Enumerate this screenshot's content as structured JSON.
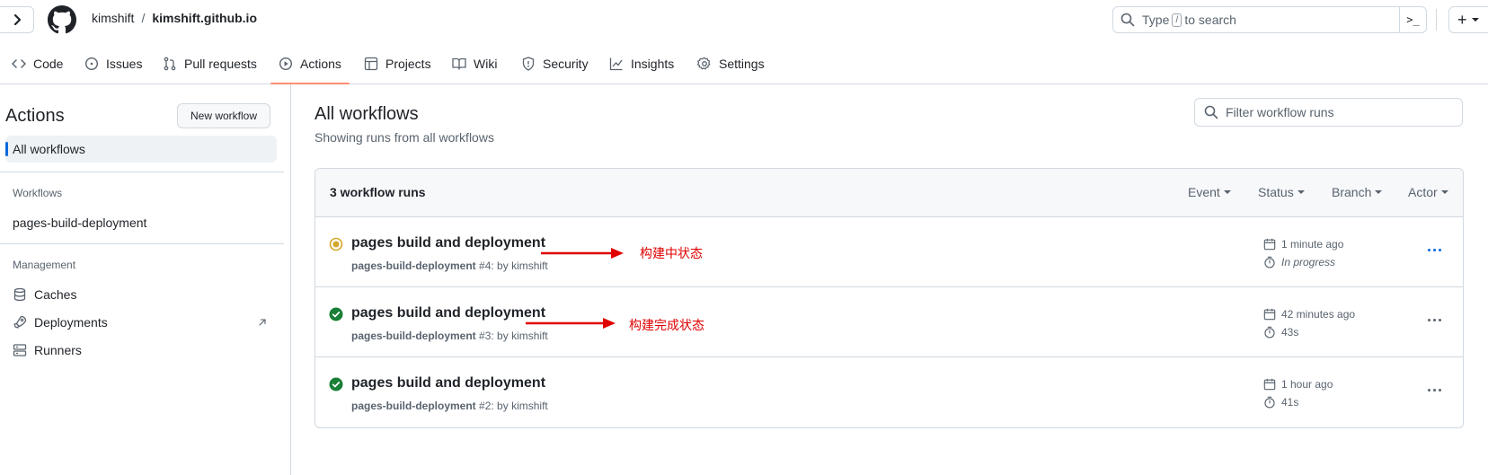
{
  "header": {
    "owner": "kimshift",
    "separator": "/",
    "repo": "kimshift.github.io",
    "search_prefix": "Type",
    "search_key": "/",
    "search_suffix": "to search",
    "terminal_glyph": ">_",
    "plus_glyph": "+"
  },
  "tabs": [
    {
      "label": "Code",
      "icon": "code-icon"
    },
    {
      "label": "Issues",
      "icon": "issue-icon"
    },
    {
      "label": "Pull requests",
      "icon": "pull-request-icon"
    },
    {
      "label": "Actions",
      "icon": "play-icon",
      "active": true
    },
    {
      "label": "Projects",
      "icon": "table-icon"
    },
    {
      "label": "Wiki",
      "icon": "book-icon"
    },
    {
      "label": "Security",
      "icon": "shield-icon"
    },
    {
      "label": "Insights",
      "icon": "graph-icon"
    },
    {
      "label": "Settings",
      "icon": "gear-icon"
    }
  ],
  "sidebar": {
    "title": "Actions",
    "new_workflow": "New workflow",
    "all_workflows": "All workflows",
    "workflows_heading": "Workflows",
    "workflow_item": "pages-build-deployment",
    "management_heading": "Management",
    "management_items": [
      {
        "label": "Caches",
        "icon": "database-icon"
      },
      {
        "label": "Deployments",
        "icon": "rocket-icon"
      },
      {
        "label": "Runners",
        "icon": "server-icon"
      }
    ]
  },
  "main": {
    "title": "All workflows",
    "subtitle": "Showing runs from all workflows",
    "filter_placeholder": "Filter workflow runs",
    "runs_count": "3 workflow runs",
    "filters": [
      "Event",
      "Status",
      "Branch",
      "Actor"
    ],
    "runs": [
      {
        "title": "pages build and deployment",
        "workflow": "pages-build-deployment",
        "run": "#4",
        "by": "kimshift",
        "time": "1 minute ago",
        "duration": "In progress",
        "status": "in_progress"
      },
      {
        "title": "pages build and deployment",
        "workflow": "pages-build-deployment",
        "run": "#3",
        "by": "kimshift",
        "time": "42 minutes ago",
        "duration": "43s",
        "status": "success"
      },
      {
        "title": "pages build and deployment",
        "workflow": "pages-build-deployment",
        "run": "#2",
        "by": "kimshift",
        "time": "1 hour ago",
        "duration": "41s",
        "status": "success"
      }
    ]
  },
  "annotations": [
    "构建中状态",
    "构建完成状态"
  ],
  "colors": {
    "accent_underline": "#fd8c73",
    "success": "#1a7f37",
    "in_progress": "#d4a72c",
    "link_blue": "#0969da",
    "annotation_red": "#e00000"
  }
}
